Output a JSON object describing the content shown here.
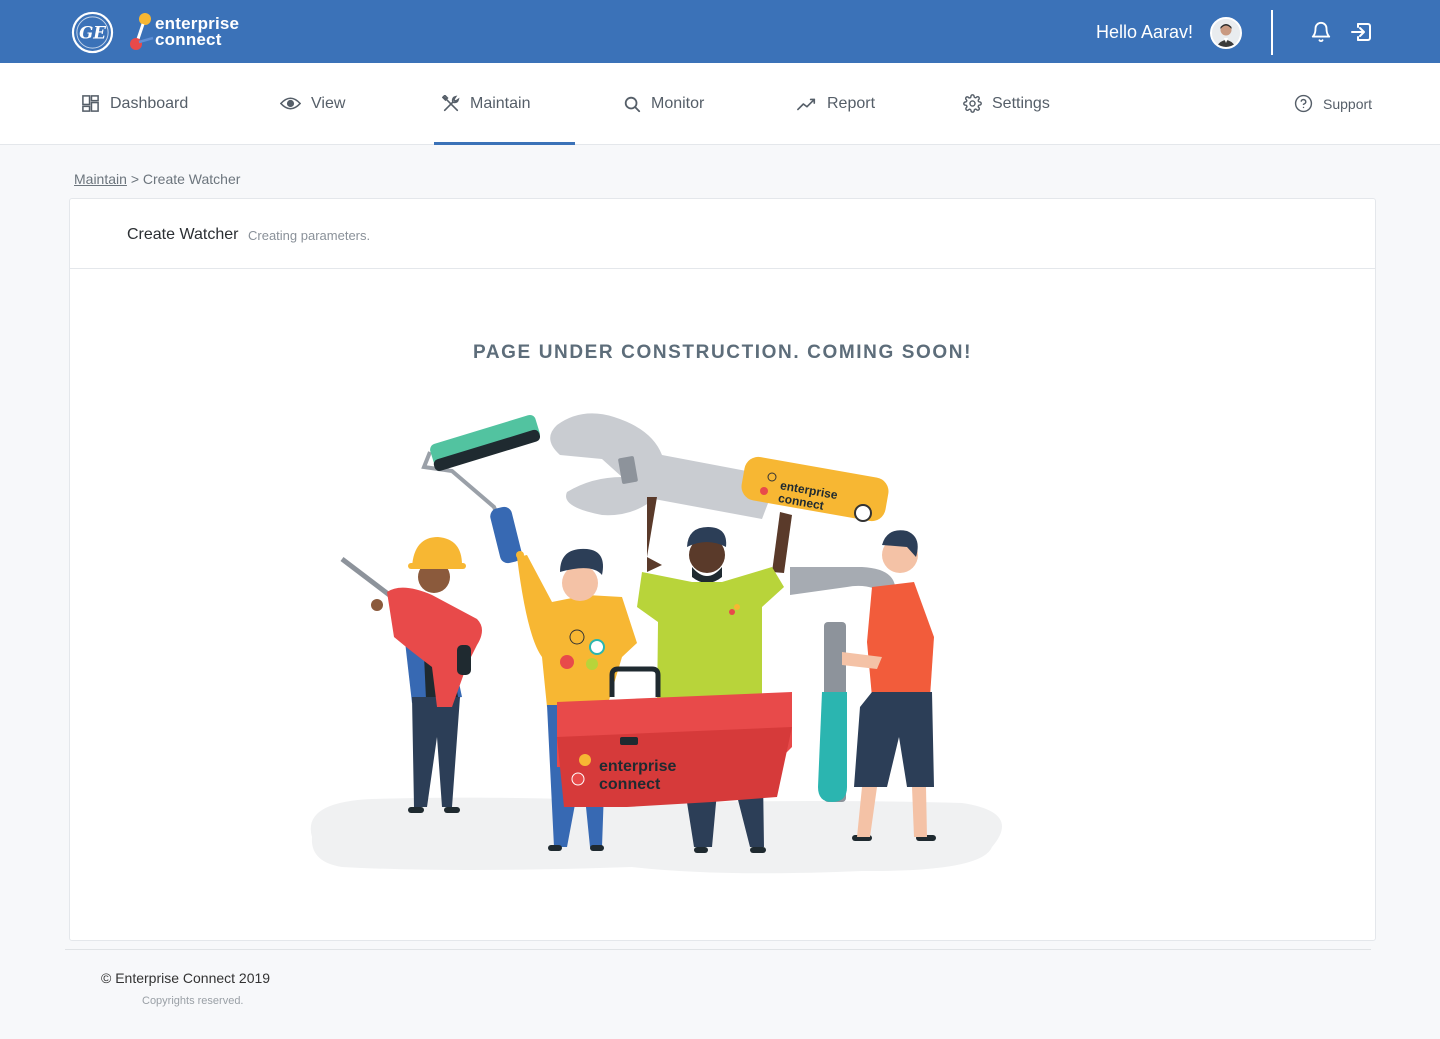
{
  "header": {
    "brand_line1": "enterprise",
    "brand_line2": "connect",
    "greeting": "Hello Aarav!",
    "icons": [
      "ge-logo-icon",
      "bell-icon",
      "logout-icon"
    ]
  },
  "nav": {
    "items": [
      {
        "label": "Dashboard",
        "icon": "dashboard-icon"
      },
      {
        "label": "View",
        "icon": "eye-icon"
      },
      {
        "label": "Maintain",
        "icon": "tools-icon",
        "active": true
      },
      {
        "label": "Monitor",
        "icon": "search-icon"
      },
      {
        "label": "Report",
        "icon": "trend-icon"
      },
      {
        "label": "Settings",
        "icon": "gear-icon"
      }
    ],
    "support_label": "Support"
  },
  "breadcrumb": {
    "parent": "Maintain",
    "separator": ">",
    "current": "Create Watcher"
  },
  "card": {
    "title": "Create Watcher",
    "subtitle": "Creating parameters.",
    "message": "PAGE UNDER CONSTRUCTION. COMING SOON!",
    "illustration_brand_1": "enterprise",
    "illustration_brand_2": "connect"
  },
  "footer": {
    "copyright": "© Enterprise Connect 2019",
    "rights": "Copyrights reserved."
  },
  "colors": {
    "primary": "#3b72b8",
    "accent_orange": "#f7b733",
    "accent_red": "#e84a4a",
    "accent_green": "#b8d43a",
    "accent_teal": "#2bb5b0"
  }
}
